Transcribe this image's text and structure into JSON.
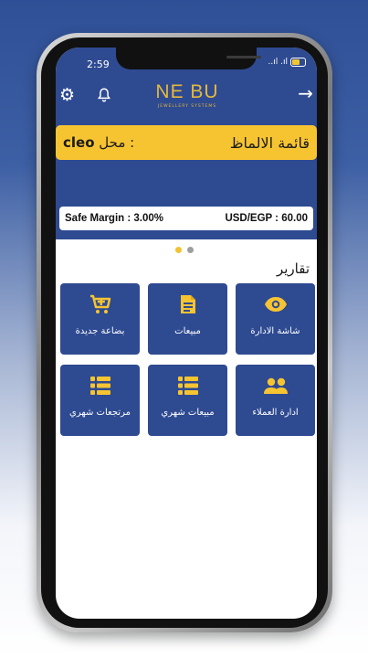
{
  "status_bar": {
    "time": "2:59",
    "signal_text": "..ıl .ıl"
  },
  "header": {
    "logo_main": "NE BU",
    "logo_sub": "JEWELLERY SYSTEMS",
    "settings_icon": "gear-icon",
    "notifications_icon": "bell-icon",
    "back_icon": "arrow-right-icon"
  },
  "banner": {
    "shop_label": "محل :",
    "shop_name": "cleo",
    "list_title": "قائمة الالماظ"
  },
  "rates": {
    "safe_margin": "Safe Margin : 3.00%",
    "usd_egp": "USD/EGP : 60.00"
  },
  "carousel": {
    "active_index": 0,
    "count": 2
  },
  "reports": {
    "title": "تقارير",
    "tiles": [
      {
        "label": "شاشة الادارة",
        "icon": "eye-icon"
      },
      {
        "label": "مبيعات",
        "icon": "document-icon"
      },
      {
        "label": "بضاعة جديدة",
        "icon": "cart-plus-icon"
      },
      {
        "label": "ادارة العملاء",
        "icon": "users-icon"
      },
      {
        "label": "مبيعات شهري",
        "icon": "list-icon"
      },
      {
        "label": "مرتجعات شهري",
        "icon": "list-icon"
      }
    ]
  },
  "colors": {
    "brand_blue": "#2e4a91",
    "accent_yellow": "#f7c431",
    "logo_gold": "#e5b93b"
  }
}
